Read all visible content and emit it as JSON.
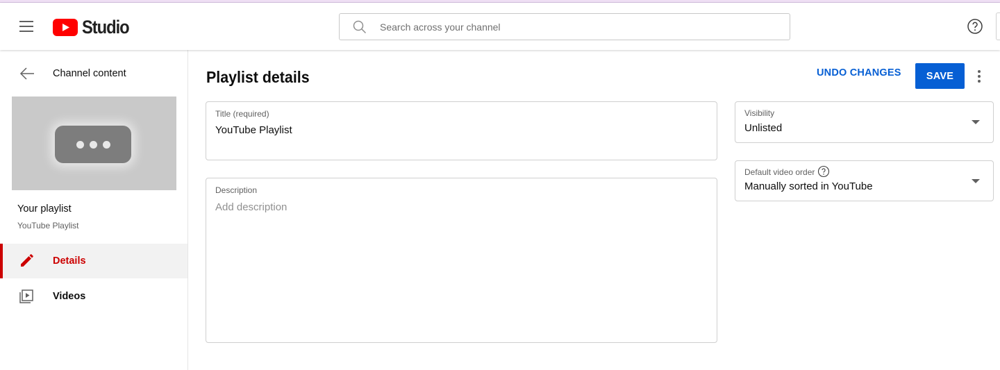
{
  "header": {
    "logo_text": "Studio",
    "search_placeholder": "Search across your channel"
  },
  "sidebar": {
    "back_label": "Channel content",
    "playlist_title": "Your playlist",
    "playlist_name": "YouTube Playlist",
    "nav": [
      {
        "label": "Details",
        "icon": "pencil-icon",
        "active": true
      },
      {
        "label": "Videos",
        "icon": "video-list-icon",
        "active": false
      }
    ]
  },
  "main": {
    "page_title": "Playlist details",
    "undo_label": "UNDO CHANGES",
    "save_label": "SAVE",
    "title_field": {
      "label": "Title (required)",
      "value": "YouTube Playlist"
    },
    "description_field": {
      "label": "Description",
      "placeholder": "Add description"
    },
    "visibility": {
      "label": "Visibility",
      "value": "Unlisted"
    },
    "video_order": {
      "label": "Default video order",
      "value": "Manually sorted in YouTube"
    }
  },
  "colors": {
    "accent_blue": "#065fd4",
    "active_red": "#cc0000",
    "logo_red": "#ff0000"
  }
}
